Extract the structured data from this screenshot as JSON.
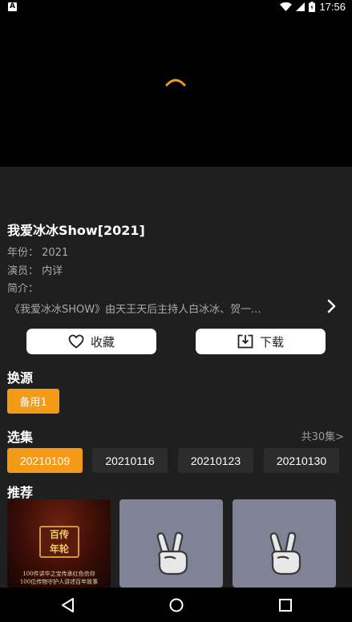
{
  "status_bar": {
    "notification_icon": "A",
    "time": "17:56",
    "icons": [
      "wifi-icon",
      "signal-icon",
      "battery-icon"
    ]
  },
  "video": {
    "loading": true
  },
  "show": {
    "title": "我爱冰冰Show[2021]",
    "year_line": "年份：  2021",
    "cast_line": "演员：  内详",
    "intro_label": "简介：",
    "description": "《我爱冰冰SHOW》由天王天后主持人白冰冰、贺一..."
  },
  "actions": {
    "favorite_label": "收藏",
    "download_label": "下载"
  },
  "source": {
    "section_title": "换源",
    "selected": "备用1"
  },
  "episodes": {
    "section_title": "选集",
    "all_link": "共30集>",
    "items": [
      {
        "label": "20210109",
        "active": true
      },
      {
        "label": "20210116",
        "active": false
      },
      {
        "label": "20210123",
        "active": false
      },
      {
        "label": "20210130",
        "active": false
      }
    ]
  },
  "recommend": {
    "section_title": "推荐",
    "poster": {
      "badge_line1": "百传",
      "badge_line2": "年轮",
      "caption_line1": "100件讲华之宝传承红色信仰",
      "caption_line2": "100位传物守护人讲述百年故事"
    }
  },
  "colors": {
    "accent": "#f49a16",
    "panel_bg": "#1f1f1f",
    "chip_bg": "#2c2c2c",
    "placeholder_bg": "#7f8395"
  }
}
